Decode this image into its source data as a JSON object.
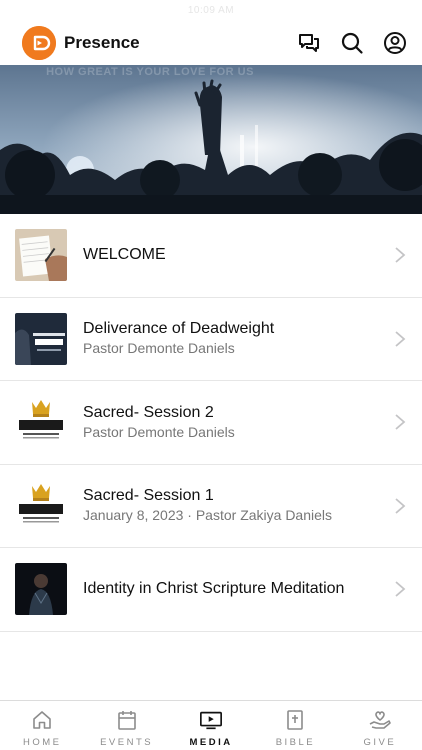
{
  "status_bar": {
    "time": "10:09 AM"
  },
  "header": {
    "app_name": "Presence",
    "icons": [
      "logo-icon",
      "chat-icon",
      "search-icon",
      "account-icon"
    ],
    "accent_color": "#f07a1e"
  },
  "hero": {
    "overlay_text": "HOW GREAT IS YOUR LOVE FOR US"
  },
  "media": {
    "items": [
      {
        "title": "WELCOME",
        "subtitle": ""
      },
      {
        "title": "Deliverance of Deadweight",
        "subtitle": "Pastor Demonte Daniels"
      },
      {
        "title": "Sacred- Session 2",
        "subtitle": "Pastor Demonte Daniels"
      },
      {
        "title": "Sacred- Session 1",
        "subtitle": "January 8, 2023 · Pastor Zakiya Daniels"
      },
      {
        "title": "Identity in Christ Scripture Meditation",
        "subtitle": ""
      }
    ]
  },
  "tabs": [
    {
      "label": "HOME",
      "icon": "home-icon",
      "active": false
    },
    {
      "label": "EVENTS",
      "icon": "calendar-icon",
      "active": false
    },
    {
      "label": "MEDIA",
      "icon": "media-play-icon",
      "active": true
    },
    {
      "label": "BIBLE",
      "icon": "bible-icon",
      "active": false
    },
    {
      "label": "GIVE",
      "icon": "give-hand-heart-icon",
      "active": false
    }
  ]
}
